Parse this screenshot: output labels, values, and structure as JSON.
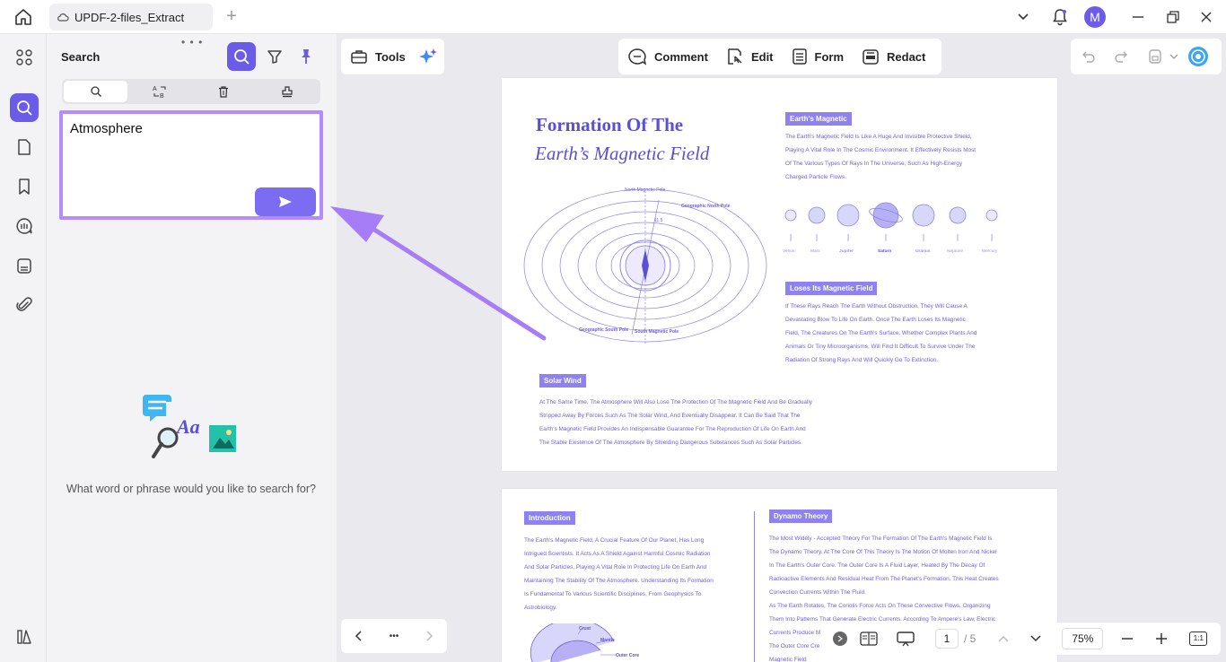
{
  "titlebar": {
    "tab_label": "UPDF-2-files_Extract",
    "add_tab": "+",
    "avatar_initial": "M"
  },
  "panel": {
    "title": "Search",
    "grip": "• • •",
    "search_value": "Atmosphere",
    "empty_prompt": "What word or phrase would you like to search for?"
  },
  "toolbar": {
    "tools_label": "Tools",
    "comment_label": "Comment",
    "edit_label": "Edit",
    "form_label": "Form",
    "redact_label": "Redact"
  },
  "page1": {
    "title_line1": "Formation Of The",
    "title_line2": "Earth’s Magnetic Field",
    "diagram_labels": {
      "north_magnetic_pole": "North Magnetic Pole",
      "geographic_north_pole": "Geographic North Pole",
      "geographic_south_pole": "Geographic South Pole",
      "south_magnetic_pole": "South Magnetic Pole",
      "angle": "11.5"
    },
    "earths_magnetic_tag": "Earth's Magnetic",
    "earths_magnetic_text": [
      "The Earth's Magnetic Field Is Like A Huge And Invisible Protective Shield,",
      "Playing A Vital Role In The Cosmic Environment. It Effectively Resists Most",
      "Of The Various Types Of Rays In The Universe, Such As High-Energy",
      "Charged Particle Flows."
    ],
    "planets": [
      "Venus",
      "Mars",
      "Jupiter",
      "Saturn",
      "Uranus",
      "Neptune",
      "Mercury"
    ],
    "loses_tag": "Loses Its Magnetic Field",
    "loses_text": [
      "If These Rays Reach The Earth Without Obstruction, They Will Cause A",
      "Devastating Blow To Life On Earth. Once The Earth Loses Its Magnetic",
      "Field, The Creatures On The Earth's Surface, Whether Complex Plants And",
      "Animals Or Tiny Microorganisms, Will Find It Difficult To Survive Under The",
      "Radiation Of Strong Rays And Will Quickly Go To Extinction."
    ],
    "solar_tag": "Solar Wind",
    "solar_text": [
      "At The Same Time, The Atmosphere Will Also Lose The Protection Of The Magnetic Field And Be Gradually",
      "Stripped Away By Forces Such As The Solar Wind, And Eventually Disappear. It Can Be Said That The",
      "Earth's Magnetic Field Provides An Indispensable Guarantee For The Reproduction Of Life On Earth And",
      "The Stable Existence Of The Atmosphere By Shielding Dangerous Substances Such As Solar Particles."
    ]
  },
  "page2": {
    "intro_tag": "Introduction",
    "intro_text": [
      "The Earth's Magnetic Field, A Crucial Feature Of Our Planet, Has Long",
      "Intrigued Scientists. It Acts As A Shield Against Harmful Cosmic Radiation",
      "And Solar Particles, Playing A Vital Role In Protecting Life On Earth And",
      "Maintaining The Stability Of The Atmosphere. Understanding Its Formation",
      "Is Fundamental To Various Scientific Disciplines, From Geophysics To",
      "Astrobiology."
    ],
    "diagram_labels": {
      "crust": "Crust",
      "mantle": "Mantle",
      "outer_core": "Outer Core"
    },
    "dynamo_tag": "Dynamo Theory",
    "dynamo_text": [
      "The Most Widely - Accepted Theory For The Formation Of The Earth's Magnetic Field Is",
      "The Dynamo Theory. At The Core Of This Theory Is The Motion Of Molten Iron And Nickel",
      "In The Earth's Outer Core. The Outer Core Is A Fluid Layer, Heated By The Decay Of",
      "Radioactive Elements And Residual Heat From The Planet's Formation. This Heat Creates",
      "Convection Currents Within The Fluid.",
      "As The Earth Rotates, The Coriolis Force Acts On These Convective Flows, Organizing",
      "Them Into Patterns That Generate Electric Currents. According To Ampere's Law, Electric",
      "Currents Produce M",
      "The Outer Core Cre",
      "Magnetic Field"
    ]
  },
  "bottom": {
    "more": "•••",
    "current_page": "1",
    "total_pages": "/ 5",
    "zoom": "75%",
    "fit": "1:1"
  },
  "colors": {
    "accent": "#6a5ce8",
    "highlight_border": "#b48cff",
    "arrow": "#a67cf7"
  }
}
